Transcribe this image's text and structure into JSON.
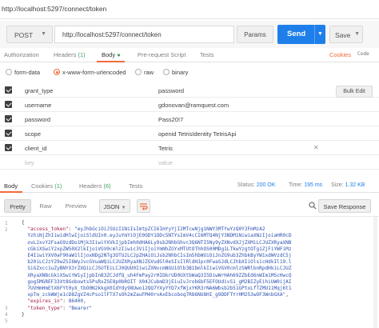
{
  "window": {
    "tab_title": "http://localhost:5297/connect/token"
  },
  "request": {
    "method": "POST",
    "url": "http://localhost:5297/connect/token",
    "params_label": "Params",
    "send_label": "Send",
    "save_label": "Save"
  },
  "req_tabs": {
    "authorization": "Authorization",
    "headers": "Headers",
    "headers_count": "(1)",
    "body": "Body",
    "prerequest": "Pre-request Script",
    "tests": "Tests",
    "cookies": "Cookies",
    "code": "Code"
  },
  "body_types": [
    "form-data",
    "x-www-form-urlencoded",
    "raw",
    "binary"
  ],
  "body_selected": "x-www-form-urlencoded",
  "form_fields": [
    {
      "key": "grant_type",
      "value": "password"
    },
    {
      "key": "username",
      "value": "gdonovan@ramquest.com"
    },
    {
      "key": "password",
      "value": "Pass20!7"
    },
    {
      "key": "scope",
      "value": "openid TetrisIdentity TetrisApi"
    },
    {
      "key": "client_id",
      "value": "Tetris"
    }
  ],
  "placeholder_row": {
    "key": "key",
    "value": "value"
  },
  "bulk_edit_label": "Bulk Edit",
  "response": {
    "tabs": {
      "body": "Body",
      "cookies": "Cookies",
      "cookies_count": "(1)",
      "headers": "Headers",
      "headers_count": "(6)",
      "tests": "Tests"
    },
    "status_label": "Status:",
    "status_value": "200 OK",
    "time_label": "Time:",
    "time_value": "195 ms",
    "size_label": "Size:",
    "size_value": "1.32 KB"
  },
  "view": {
    "pretty": "Pretty",
    "raw": "Raw",
    "preview": "Preview",
    "format": "JSON",
    "save_response": "Save Response"
  },
  "json_lines": [
    {
      "n": "1",
      "text": "{"
    },
    {
      "n": "2",
      "key": "\"access_token\"",
      "text": "\"eyJhbGciOiJSUzI1NiIsImtpZCI6ImYyYjI2MTcwNjg1NWY3MTYwYzQ0Y2FmMzA2YzhiNjZhIiwidHlwIjoiSldUIn0.eyJuYmYiOjE0ODY1ODc5NTYsImV4cCI6MTQ4NjY3NDM1NiwiaXNzIjoiaHR0cDovL2xvY2FsaG9zdDo1Mjk3IiwiYXVkIjpbImh0dHA6Ly9sb2NhbGhvc3Q6NTI5Ny9yZXNvdXJjZXMiLCJUZXRyaXNBcGkiXSwiY2xpZW50X2lkIjoiVGV0cmlzIiwic3ViIjoiYmNhZGYxMTUtOThhOS00MDg1LTkwYzgtOTg1ZjFiYWFiMzE4IiwiYXV0aF90aW1lIjoxNDg2NTg3OTU2LCJpZHAiOiJsb2NhbCIsIm5hbWUiOiJnZG9ub3ZhbkByYW1xdWVzdC5jb20iLCJzY29wZSI6WyJvcGVuaWQiLCJUZXRyaXNJZGVudGl0eSIsIlRldHJpc0FwaSJdLCJhbXIiOlsicHdkIl19.lSiGZxcc1uZyBNYX3rZXQiLCJ5UTEiLCJ0QUU0IiwiZXNvcmNGU1Olb3B1bmlkIiwiVGV0cmlzSWRlbnRpdHkiLCJUZXRyaXNBcGkiXSwiYW1yIjpbInB3ZCJdfQ_uh4FmPay2rHIDkrUD0UXtbWaQ3I5DiwWrHAh69ZZbEd6nWIm1MScHwcQgog5MGREF33Xt8Gobowts5PsRxZSE8p0bROIT X04JCubmD3jEiuIvJrob6bF5EFOUdivS1_gM2BIZyEihiUW0ijAI7UVHmHmEtX6FYt0yX_tbO0N2kkgX0IdYdy98Uwo12QQ7YXyYYD7xfWjxYKR3rNA6Wbsb2b51GPtxLfTZMU11Mqj6t1xpTm_zckWWje1cD8ZgVZ4cPso1lFTX7sOh2mZauFM40rvAxEbcoboq7R86NU8HI_g9DDFTYrHM253wOF3WnbGXA\""
    },
    {
      "n": "3",
      "key": "\"expires_in\"",
      "text": "86400"
    },
    {
      "n": "4",
      "key": "\"token_type\"",
      "text": "\"Bearer\""
    },
    {
      "n": "5",
      "text": "}"
    }
  ],
  "colors": {
    "accent": "#f26b3a",
    "send": "#1f7fea",
    "status": "#1f7fea",
    "json_key": "#a11c4c",
    "json_string": "#2f53b3"
  },
  "icons": [
    "chevron-down-icon",
    "delete-icon",
    "wrap-lines-icon",
    "search-icon"
  ]
}
